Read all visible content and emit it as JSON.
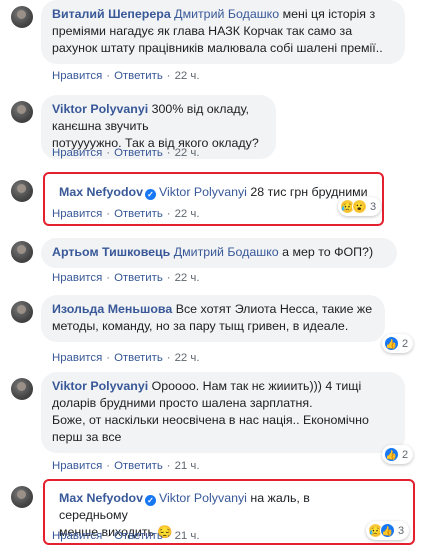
{
  "comments": [
    {
      "author": "Виталий Шеперера",
      "mention": "Дмитрий Бодашко",
      "text_lines": [
        "мені ця історія з",
        "преміями нагадує як глава НАЗК Корчак так само за",
        "рахунок штату працівників малювала собі шалені премії.."
      ],
      "like": "Нравится",
      "reply": "Ответить",
      "time": "22 ч."
    },
    {
      "author": "Viktor Polyvanyi",
      "text_lines": [
        "300% від окладу, канєшна звучить",
        "потуууужно. Так а від якого окладу?"
      ],
      "like": "Нравится",
      "reply": "Ответить",
      "time": "22 ч."
    },
    {
      "author": "Max Nefyodov",
      "verified": true,
      "mention": "Viktor Polyvanyi",
      "text": "28 тис грн брудними",
      "like": "Нравится",
      "reply": "Ответить",
      "time": "22 ч.",
      "reactions": {
        "icons": [
          "sad-icon",
          "wow-icon"
        ],
        "count": "3"
      }
    },
    {
      "author": "Артьом Тишковець",
      "mention": "Дмитрий Бодашко",
      "text": "а мер то ФОП?)",
      "like": "Нравится",
      "reply": "Ответить",
      "time": "22 ч."
    },
    {
      "author": "Изольда Меньшова",
      "text_lines": [
        "Все хотят Элиота Несса, такие же",
        "методы, команду, но за пару тыщ гривен, в идеале."
      ],
      "like": "Нравится",
      "reply": "Ответить",
      "time": "22 ч.",
      "reactions": {
        "icons": [
          "like-icon"
        ],
        "count": "2"
      }
    },
    {
      "author": "Viktor Polyvanyi",
      "text_lines": [
        "Ороооо. Нам так нє жииить))) 4 тищі",
        "доларів брудними просто шалена зарплатня.",
        "Боже, от наскільки неосвічена в нас нація.. Економічно",
        "перш за все"
      ],
      "like": "Нравится",
      "reply": "Ответить",
      "time": "21 ч.",
      "reactions": {
        "icons": [
          "like-icon"
        ],
        "count": "2"
      }
    },
    {
      "author": "Max Nefyodov",
      "verified": true,
      "mention": "Viktor Polyvanyi",
      "text_lines": [
        "на жаль, в середньому",
        "менше виходить 😔"
      ],
      "like": "Нравится",
      "reply": "Ответить",
      "time": "21 ч.",
      "reactions": {
        "icons": [
          "sad-icon",
          "like-icon"
        ],
        "count": "3"
      }
    }
  ],
  "colors": {
    "highlight": "#e5202e",
    "link": "#385898",
    "bubble": "#f2f3f5",
    "like_blue": "#1877f2"
  }
}
